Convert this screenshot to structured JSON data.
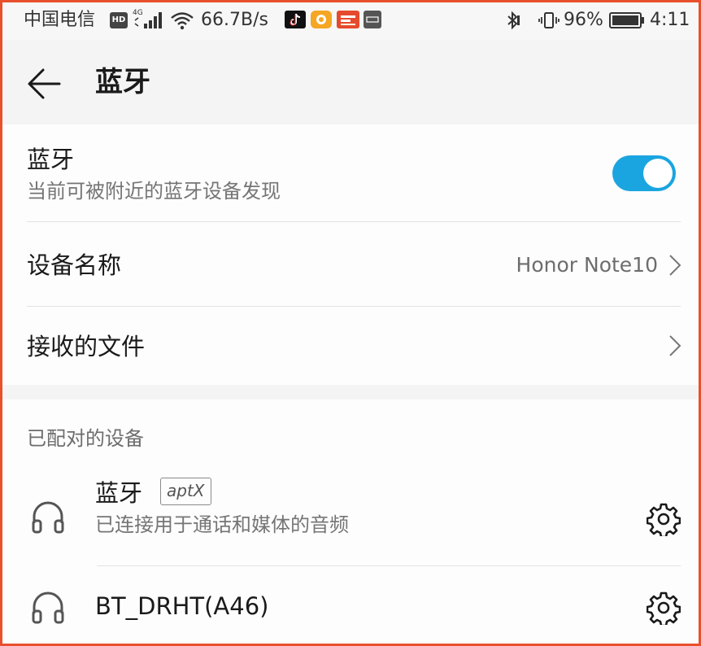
{
  "status_bar": {
    "carrier": "中国电信",
    "hd_badge": "HD",
    "network_type": "4G",
    "speed": "66.7B/s",
    "battery_percent": "96%",
    "time": "4:11",
    "notification_icons": [
      "tiktok-icon",
      "orange-app-icon",
      "news-app-icon",
      "gray-app-icon"
    ]
  },
  "header": {
    "title": "蓝牙"
  },
  "bluetooth_toggle": {
    "title": "蓝牙",
    "subtitle": "当前可被附近的蓝牙设备发现",
    "enabled": true,
    "accent_color": "#1aa5e0"
  },
  "device_name_row": {
    "label": "设备名称",
    "value": "Honor Note10"
  },
  "received_files_row": {
    "label": "接收的文件"
  },
  "paired_section": {
    "label": "已配对的设备",
    "devices": [
      {
        "name": "蓝牙",
        "codec": "aptX",
        "status": "已连接用于通话和媒体的音频"
      },
      {
        "name": "BT_DRHT(A46)"
      }
    ]
  }
}
